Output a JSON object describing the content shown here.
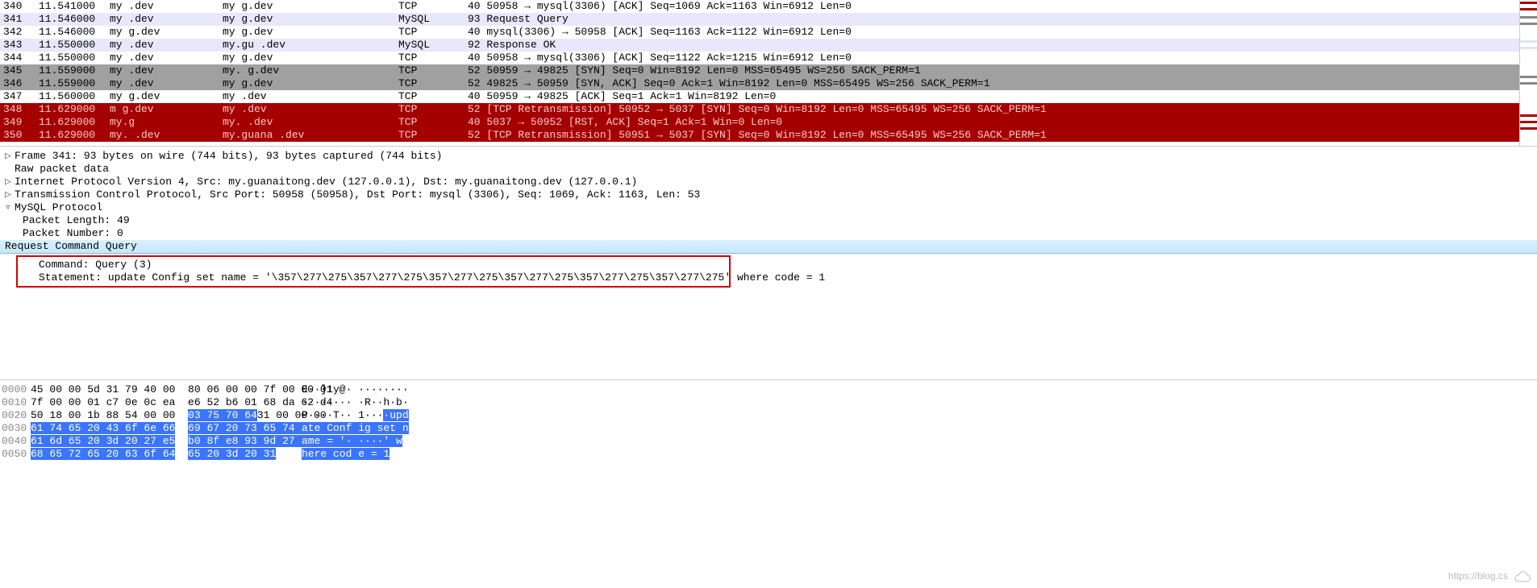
{
  "packets": [
    {
      "no": "340",
      "time": "11.541000",
      "src": "my            .dev",
      "dst": "my             g.dev",
      "proto": "TCP",
      "info": "40 50958 → mysql(3306) [ACK] Seq=1069 Ack=1163 Win=6912 Len=0",
      "cls": ""
    },
    {
      "no": "341",
      "time": "11.546000",
      "src": "my            .dev",
      "dst": "my             g.dev",
      "proto": "MySQL",
      "info": "93 Request Query",
      "cls": "row-light"
    },
    {
      "no": "342",
      "time": "11.546000",
      "src": "my            g.dev",
      "dst": "my            g.dev",
      "proto": "TCP",
      "info": "40 mysql(3306) → 50958 [ACK] Seq=1163 Ack=1122 Win=6912 Len=0",
      "cls": ""
    },
    {
      "no": "343",
      "time": "11.550000",
      "src": "my            .dev",
      "dst": "my.gu         .dev",
      "proto": "MySQL",
      "info": "92 Response OK",
      "cls": "row-light"
    },
    {
      "no": "344",
      "time": "11.550000",
      "src": "my            .dev",
      "dst": "my            g.dev",
      "proto": "TCP",
      "info": "40 50958 → mysql(3306) [ACK] Seq=1122 Ack=1215 Win=6912 Len=0",
      "cls": ""
    },
    {
      "no": "345",
      "time": "11.559000",
      "src": "my            .dev",
      "dst": "my.           g.dev",
      "proto": "TCP",
      "info": "52 50959 → 49825 [SYN] Seq=0 Win=8192 Len=0 MSS=65495 WS=256 SACK_PERM=1",
      "cls": "row-gray"
    },
    {
      "no": "346",
      "time": "11.559000",
      "src": "my            .dev",
      "dst": "my            g.dev",
      "proto": "TCP",
      "info": "52 49825 → 50959 [SYN, ACK] Seq=0 Ack=1 Win=8192 Len=0 MSS=65495 WS=256 SACK_PERM=1",
      "cls": "row-gray"
    },
    {
      "no": "347",
      "time": "11.560000",
      "src": "my            g.dev",
      "dst": "my            .dev",
      "proto": "TCP",
      "info": "40 50959 → 49825 [ACK] Seq=1 Ack=1 Win=8192 Len=0",
      "cls": ""
    },
    {
      "no": "348",
      "time": "11.629000",
      "src": "m             g.dev",
      "dst": "my            .dev",
      "proto": "TCP",
      "info": "52 [TCP Retransmission] 50952 → 5037 [SYN] Seq=0 Win=8192 Len=0 MSS=65495 WS=256 SACK_PERM=1",
      "cls": "row-red"
    },
    {
      "no": "349",
      "time": "11.629000",
      "src": "my.g",
      "dst": "my.           .dev",
      "proto": "TCP",
      "info": "40 5037 → 50952 [RST, ACK] Seq=1 Ack=1 Win=0 Len=0",
      "cls": "row-red"
    },
    {
      "no": "350",
      "time": "11.629000",
      "src": "my.           .dev",
      "dst": "my.guana      .dev",
      "proto": "TCP",
      "info": "52 [TCP Retransmission] 50951 → 5037 [SYN] Seq=0 Win=8192 Len=0 MSS=65495 WS=256 SACK_PERM=1",
      "cls": "row-red"
    }
  ],
  "detail": {
    "frame": "Frame 341: 93 bytes on wire (744 bits), 93 bytes captured (744 bits)",
    "raw": "Raw packet data",
    "ip": "Internet Protocol Version 4, Src: my.guanaitong.dev (127.0.0.1), Dst: my.guanaitong.dev (127.0.0.1)",
    "tcp": "Transmission Control Protocol, Src Port: 50958 (50958), Dst Port: mysql (3306), Seq: 1069, Ack: 1163, Len: 53",
    "mysql": "MySQL Protocol",
    "plen": "Packet Length: 49",
    "pnum": "Packet Number: 0",
    "reqcmd": "Request Command Query",
    "cmd": "Command: Query (3)",
    "stmt": "Statement: update Config set name = '\\357\\277\\275\\357\\277\\275\\357\\277\\275\\357\\277\\275\\357\\277\\275\\357\\277\\275' where code = 1"
  },
  "hex": [
    {
      "off": "0000",
      "b1": "45 00 00 5d 31 79 40 00",
      "b2": "80 06 00 00 7f 00 00 01",
      "a": "E··]1y@· ········"
    },
    {
      "off": "0010",
      "b1": "7f 00 00 01 c7 0e 0c ea",
      "b2": "e6 52 b6 01 68 da 62 d4",
      "a": "········ ·R··h·b·"
    },
    {
      "off": "0020",
      "b1": "50 18 00 1b 88 54 00 00",
      "b2": "31 00 00 00 ",
      "b2h": "03 75 70 64",
      "a": "P····T·· 1···",
      "ah": "·upd"
    },
    {
      "off": "0030",
      "b1h": "61 74 65 20 43 6f 6e 66",
      "b2h": "69 67 20 73 65 74 20 6e",
      "ah": "ate Conf ig set n"
    },
    {
      "off": "0040",
      "b1h": "61 6d 65 20 3d 20 27 e5",
      "b2h": "b0 8f e8 93 9d 27 20 77",
      "ah": "ame = '· ····' w"
    },
    {
      "off": "0050",
      "b1h": "68 65 72 65 20 63 6f 64",
      "b2h": "65 20 3d 20 31",
      "ah": "here cod e = 1"
    }
  ],
  "watermark": "https://blog.cs"
}
